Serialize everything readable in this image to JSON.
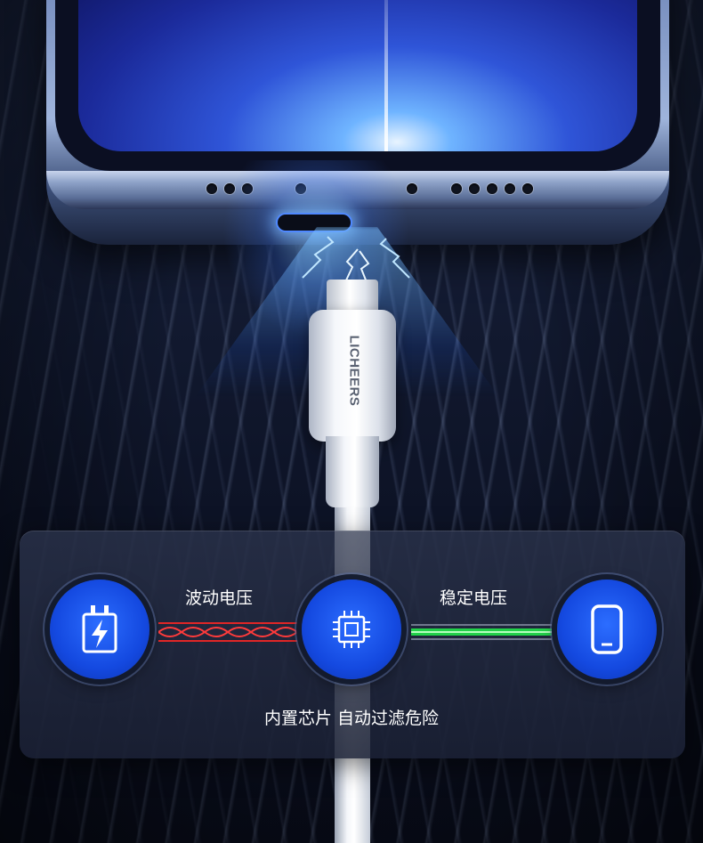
{
  "brand": {
    "name": "LICHEERS"
  },
  "flow": {
    "left_label": "波动电压",
    "right_label": "稳定电压",
    "caption": "内置芯片 自动过滤危险"
  },
  "icons": {
    "left": "charger-bolt-icon",
    "center": "chip-icon",
    "right": "smartphone-icon"
  },
  "colors": {
    "accent_blue": "#1a55f0",
    "unstable_red": "#e02626",
    "stable_green": "#22d04a"
  }
}
